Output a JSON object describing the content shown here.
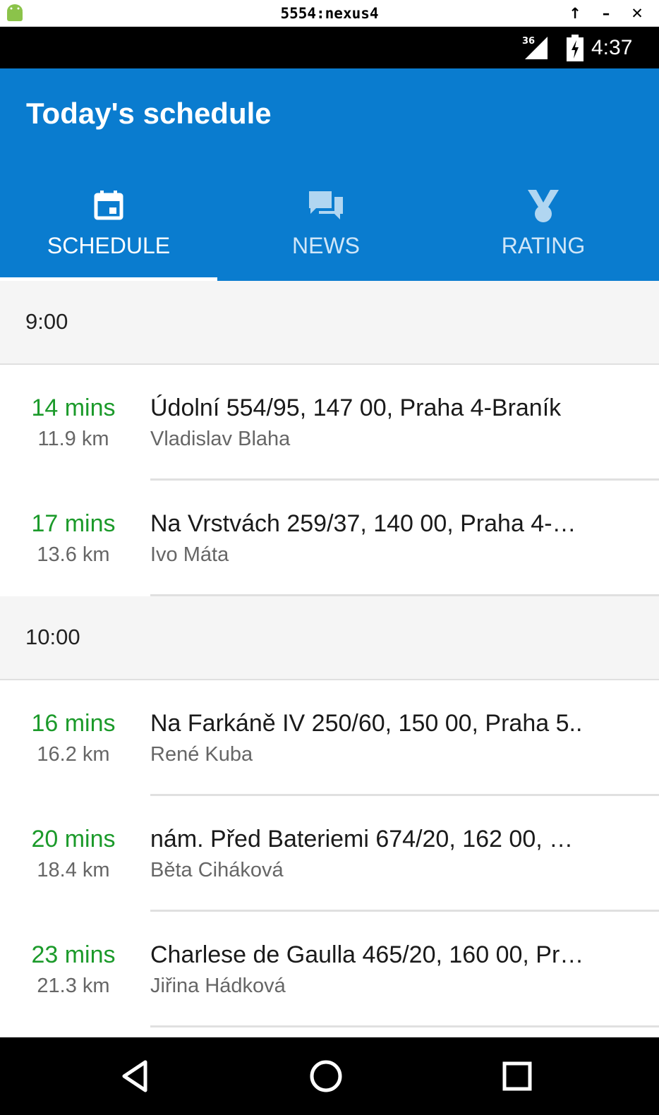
{
  "emulator": {
    "title": "5554:nexus4",
    "controls": [
      "↑",
      "–",
      "✕"
    ]
  },
  "status_bar": {
    "network": "36",
    "time": "4:37"
  },
  "app_bar": {
    "title": "Today's schedule",
    "color": "#0a7ccf"
  },
  "tabs": [
    {
      "label": "SCHEDULE",
      "icon": "calendar-icon",
      "selected": true
    },
    {
      "label": "NEWS",
      "icon": "chat-icon",
      "selected": false
    },
    {
      "label": "RATING",
      "icon": "medal-icon",
      "selected": false
    }
  ],
  "schedule": [
    {
      "time": "9:00",
      "items": [
        {
          "mins": "14 mins",
          "km": "11.9 km",
          "address": "Údolní 554/95, 147 00, Praha 4-Braník",
          "name": "Vladislav Blaha"
        },
        {
          "mins": "17 mins",
          "km": "13.6 km",
          "address": "Na Vrstvách 259/37, 140 00, Praha 4-…",
          "name": "Ivo Máta"
        }
      ]
    },
    {
      "time": "10:00",
      "items": [
        {
          "mins": "16 mins",
          "km": "16.2 km",
          "address": "Na Farkáně IV 250/60, 150 00, Praha 5..",
          "name": "René Kuba"
        },
        {
          "mins": "20 mins",
          "km": "18.4 km",
          "address": "nám. Před Bateriemi 674/20, 162 00, …",
          "name": "Běta Ciháková"
        },
        {
          "mins": "23 mins",
          "km": "21.3 km",
          "address": "Charlese de Gaulla 465/20, 160 00, Pr…",
          "name": "Jiřina Hádková"
        }
      ]
    }
  ],
  "nav": {
    "buttons": [
      "back-icon",
      "home-icon",
      "recents-icon"
    ]
  },
  "colors": {
    "accent": "#0a7ccf",
    "mins": "#1b9a2a"
  }
}
